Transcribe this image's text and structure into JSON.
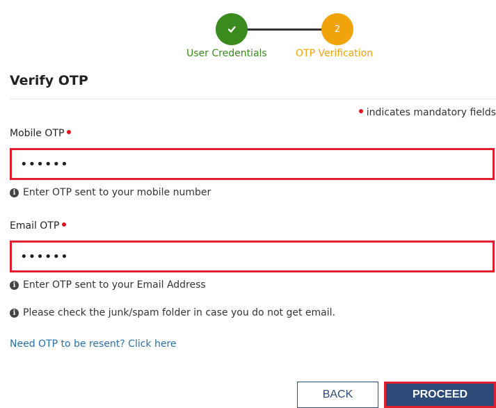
{
  "stepper": {
    "steps": [
      {
        "label": "User Credentials",
        "status": "completed",
        "icon": "check-icon",
        "color": "#3a8a1e"
      },
      {
        "label": "OTP Verification",
        "number": "2",
        "status": "current",
        "color": "#f0a30a"
      }
    ]
  },
  "page": {
    "title": "Verify OTP",
    "mandatory_note": "indicates mandatory fields"
  },
  "mobile_otp": {
    "label": "Mobile OTP",
    "value": "••••••",
    "help": "Enter OTP sent to your mobile number"
  },
  "email_otp": {
    "label": "Email OTP",
    "value": "••••••",
    "help": "Enter OTP sent to your Email Address"
  },
  "junk_note": "Please check the junk/spam folder in case you do not get email.",
  "resend_link": "Need OTP to be resent? Click here",
  "buttons": {
    "back": "BACK",
    "proceed": "PROCEED"
  },
  "colors": {
    "accent_red": "#e01f2e",
    "primary_blue": "#2c4b79",
    "link_blue": "#2a6fa8"
  }
}
